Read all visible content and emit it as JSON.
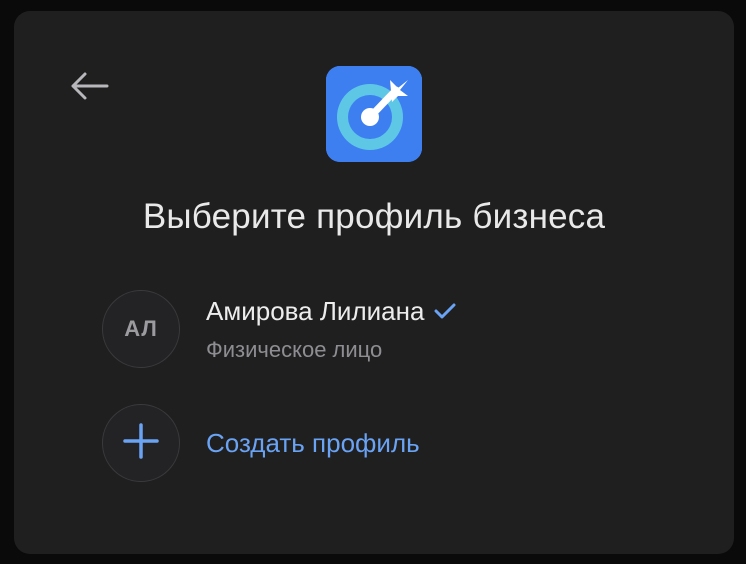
{
  "dialog": {
    "title": "Выберите профиль бизнеса",
    "back_icon": "arrow-left-icon",
    "logo_icon": "target-dart-icon"
  },
  "profiles": [
    {
      "initials": "АЛ",
      "name": "Амирова Лилиана",
      "type": "Физическое лицо",
      "verified": true,
      "verified_icon": "checkmark-icon"
    }
  ],
  "create_profile": {
    "label": "Создать профиль",
    "icon": "plus-icon"
  },
  "colors": {
    "background": "#1f1f20",
    "accent": "#6aa3f4",
    "logo_bg": "#3d7ff0",
    "logo_ring": "#5fc7e6"
  }
}
